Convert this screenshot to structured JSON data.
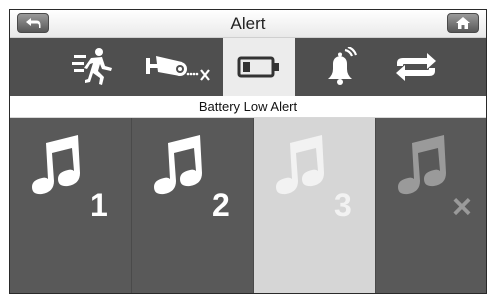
{
  "header": {
    "title": "Alert",
    "back_icon": "back-arrow-icon",
    "home_icon": "home-icon"
  },
  "tabs": [
    {
      "name": "motion-alert",
      "icon": "running-person-icon",
      "active": false
    },
    {
      "name": "camera-out-of-range",
      "icon": "camera-disconnected-icon",
      "active": false
    },
    {
      "name": "battery-low-alert",
      "icon": "battery-icon",
      "active": true
    },
    {
      "name": "sound-alert",
      "icon": "bell-ringing-icon",
      "active": false
    },
    {
      "name": "cycle",
      "icon": "repeat-arrows-icon",
      "active": false
    }
  ],
  "section": {
    "label": "Battery Low Alert"
  },
  "tones": [
    {
      "name": "tone-1",
      "icon": "music-note-icon",
      "label": "1",
      "selected": false
    },
    {
      "name": "tone-2",
      "icon": "music-note-icon",
      "label": "2",
      "selected": false
    },
    {
      "name": "tone-3",
      "icon": "music-note-icon",
      "label": "3",
      "selected": true
    },
    {
      "name": "tone-off",
      "icon": "music-note-muted-icon",
      "label": "×",
      "selected": false
    }
  ],
  "colors": {
    "tab_bar_bg": "#4f4f4f",
    "tab_active_bg": "#ececec",
    "tile_bg": "#595959",
    "tile_selected_bg": "#d6d6d6",
    "icon_white": "#ffffff",
    "icon_dim": "#9a9a9a"
  }
}
